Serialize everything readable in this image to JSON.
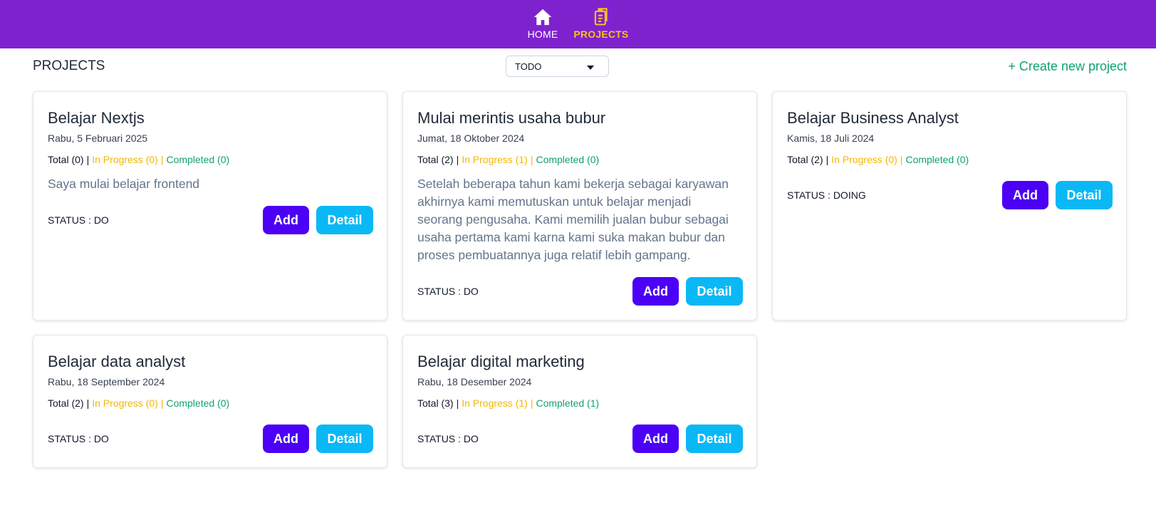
{
  "nav": {
    "home_label": "HOME",
    "projects_label": "PROJECTS",
    "home_icon": "home-icon",
    "projects_icon": "clipboard-icon",
    "bar_color": "#7e22ce",
    "active_color": "#fbbf24"
  },
  "header": {
    "title": "PROJECTS",
    "filter_value": "TODO",
    "create_label": "+ Create new project"
  },
  "colors": {
    "in_progress": "#f2b705",
    "completed": "#10a36b",
    "add_button": "#4c00f5",
    "detail_button": "#0ab8f5"
  },
  "projects": [
    {
      "title": "Belajar Nextjs",
      "date": "Rabu, 5 Februari 2025",
      "total": "Total (0)",
      "in_progress": "In Progress (0)",
      "completed": "Completed (0)",
      "description": "Saya mulai belajar frontend",
      "status": "STATUS : DO",
      "add_label": "Add",
      "detail_label": "Detail"
    },
    {
      "title": "Mulai merintis usaha bubur",
      "date": "Jumat, 18 Oktober 2024",
      "total": "Total (2)",
      "in_progress": "In Progress (1)",
      "completed": "Completed (0)",
      "description": "Setelah beberapa tahun kami bekerja sebagai karyawan akhirnya kami memutuskan untuk belajar menjadi seorang pengusaha. Kami memilih jualan bubur sebagai usaha pertama kami karna kami suka makan bubur dan proses pembuatannya juga relatif lebih gampang.",
      "status": "STATUS : DO",
      "add_label": "Add",
      "detail_label": "Detail"
    },
    {
      "title": "Belajar Business Analyst",
      "date": "Kamis, 18 Juli 2024",
      "total": "Total (2)",
      "in_progress": "In Progress (0)",
      "completed": "Completed (0)",
      "description": "",
      "status": "STATUS : DOING",
      "add_label": "Add",
      "detail_label": "Detail"
    },
    {
      "title": "Belajar data analyst",
      "date": "Rabu, 18 September 2024",
      "total": "Total (2)",
      "in_progress": "In Progress (0)",
      "completed": "Completed (0)",
      "description": "",
      "status": "STATUS : DO",
      "add_label": "Add",
      "detail_label": "Detail"
    },
    {
      "title": "Belajar digital marketing",
      "date": "Rabu, 18 Desember 2024",
      "total": "Total (3)",
      "in_progress": "In Progress (1)",
      "completed": "Completed (1)",
      "description": "",
      "status": "STATUS : DO",
      "add_label": "Add",
      "detail_label": "Detail"
    }
  ]
}
